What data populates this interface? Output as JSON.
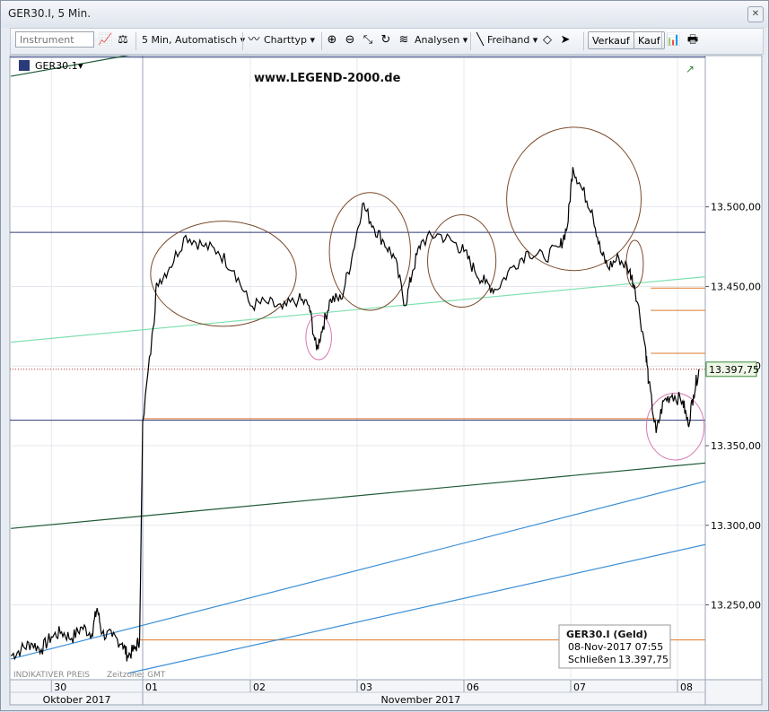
{
  "window": {
    "title": "GER30.I, 5 Min."
  },
  "toolbar": {
    "instrument_placeholder": "Instrument",
    "interval": "5 Min,  Automatisch",
    "charttype": "Charttyp",
    "analysen": "Analysen",
    "freihand": "Freihand",
    "verkauf": "Verkauf",
    "kauf": "Kauf"
  },
  "chart": {
    "symbol": "GER30.1",
    "watermark": "www.LEGEND-2000.de",
    "footer_left": "INDIKATIVER PREIS",
    "footer_zone": "Zeitzone: GMT",
    "current_price_label": "13.397,75",
    "info_box": {
      "title": "GER30.I (Geld)",
      "datetime": "08-Nov-2017 07:55",
      "close_label": "Schließen",
      "close_value": "13.397,75"
    },
    "colors": {
      "price": "#000000",
      "h_navy": "#2b3a78",
      "h_orange": "#e07a2c",
      "trend_mint": "#7fe0b0",
      "trend_dark_green": "#1f5a36",
      "trend_blue": "#3d8fd6",
      "circle_brown": "#7a4a2a",
      "circle_pink": "#d678b0"
    }
  },
  "chart_data": {
    "type": "line",
    "y_axis": {
      "range": [
        13203,
        13595
      ],
      "ticks": [
        13250,
        13300,
        13350,
        13400,
        13450,
        13500
      ],
      "tick_labels": [
        "13.250,00",
        "13.300,00",
        "13.350,00",
        "13.400,00",
        "13.450,00",
        "13.500,00"
      ]
    },
    "x_axis": {
      "day_ticks": [
        {
          "label": "30",
          "x": 0.1
        },
        {
          "label": "01",
          "x": 1
        },
        {
          "label": "02",
          "x": 2
        },
        {
          "label": "03",
          "x": 3
        },
        {
          "label": "06",
          "x": 4
        },
        {
          "label": "07",
          "x": 5
        },
        {
          "label": "08",
          "x": 6
        }
      ],
      "months": [
        {
          "label": "Oktober 2017",
          "x_start": -0.3,
          "x_end": 1
        },
        {
          "label": "November 2017",
          "x_start": 1,
          "x_end": 6.2
        }
      ]
    },
    "series": [
      {
        "points": [
          [
            -0.3,
            13218
          ],
          [
            -0.2,
            13222
          ],
          [
            -0.1,
            13226
          ],
          [
            0,
            13222
          ],
          [
            0.1,
            13230
          ],
          [
            0.2,
            13233
          ],
          [
            0.3,
            13229
          ],
          [
            0.4,
            13236
          ],
          [
            0.5,
            13232
          ],
          [
            0.55,
            13248
          ],
          [
            0.6,
            13232
          ],
          [
            0.7,
            13230
          ],
          [
            0.8,
            13226
          ],
          [
            0.85,
            13218
          ],
          [
            0.92,
            13222
          ],
          [
            0.97,
            13228
          ],
          [
            1.0,
            13365
          ],
          [
            1.1,
            13425
          ],
          [
            1.13,
            13452
          ],
          [
            1.25,
            13462
          ],
          [
            1.4,
            13482
          ],
          [
            1.55,
            13476
          ],
          [
            1.7,
            13472
          ],
          [
            1.85,
            13460
          ],
          [
            2.0,
            13438
          ],
          [
            2.15,
            13440
          ],
          [
            2.3,
            13436
          ],
          [
            2.45,
            13442
          ],
          [
            2.55,
            13438
          ],
          [
            2.62,
            13410
          ],
          [
            2.68,
            13425
          ],
          [
            2.75,
            13442
          ],
          [
            2.85,
            13442
          ],
          [
            2.95,
            13468
          ],
          [
            3.05,
            13502
          ],
          [
            3.15,
            13488
          ],
          [
            3.25,
            13478
          ],
          [
            3.35,
            13468
          ],
          [
            3.45,
            13438
          ],
          [
            3.52,
            13460
          ],
          [
            3.6,
            13478
          ],
          [
            3.75,
            13483
          ],
          [
            3.9,
            13478
          ],
          [
            4.0,
            13472
          ],
          [
            4.1,
            13460
          ],
          [
            4.2,
            13452
          ],
          [
            4.3,
            13448
          ],
          [
            4.45,
            13462
          ],
          [
            4.6,
            13472
          ],
          [
            4.75,
            13468
          ],
          [
            4.9,
            13475
          ],
          [
            4.97,
            13488
          ],
          [
            5.02,
            13525
          ],
          [
            5.1,
            13512
          ],
          [
            5.2,
            13498
          ],
          [
            5.28,
            13472
          ],
          [
            5.35,
            13462
          ],
          [
            5.45,
            13468
          ],
          [
            5.55,
            13460
          ],
          [
            5.6,
            13450
          ],
          [
            5.7,
            13412
          ],
          [
            5.73,
            13390
          ],
          [
            5.8,
            13358
          ],
          [
            5.87,
            13378
          ],
          [
            5.95,
            13382
          ],
          [
            6.05,
            13378
          ],
          [
            6.1,
            13363
          ],
          [
            6.15,
            13382
          ],
          [
            6.2,
            13398
          ]
        ]
      }
    ],
    "annotations": {
      "horizontal_lines": [
        {
          "price": 13594,
          "color": "h_navy"
        },
        {
          "price": 13484,
          "color": "h_navy"
        },
        {
          "price": 13366,
          "color": "h_navy"
        },
        {
          "price": 13449,
          "color": "h_orange",
          "x_from": 5.75
        },
        {
          "price": 13435,
          "color": "h_orange",
          "x_from": 5.75
        },
        {
          "price": 13408,
          "color": "h_orange",
          "x_from": 5.75
        },
        {
          "price": 13367,
          "color": "h_orange",
          "x_from": 1.0,
          "x_to": 5.8
        },
        {
          "price": 13228,
          "color": "h_orange",
          "x_from": 0.95
        }
      ],
      "trend_lines": [
        {
          "from": [
            -0.3,
            13415
          ],
          "to": [
            6.4,
            13457
          ],
          "color": "trend_mint"
        },
        {
          "from": [
            -0.3,
            13298
          ],
          "to": [
            6.4,
            13340
          ],
          "color": "trend_dark_green"
        },
        {
          "from": [
            -0.3,
            13216
          ],
          "to": [
            6.4,
            13330
          ],
          "color": "trend_blue"
        },
        {
          "from": [
            0.85,
            13207
          ],
          "to": [
            6.4,
            13290
          ],
          "color": "trend_blue"
        },
        {
          "from": [
            -0.3,
            13582
          ],
          "to": [
            1.6,
            13604
          ],
          "color": "trend_dark_green"
        }
      ],
      "ellipses": [
        {
          "cx": 1.75,
          "cy": 13458,
          "rx": 0.68,
          "ry": 33,
          "color": "circle_brown"
        },
        {
          "cx": 3.12,
          "cy": 13472,
          "rx": 0.38,
          "ry": 37,
          "color": "circle_brown"
        },
        {
          "cx": 3.98,
          "cy": 13466,
          "rx": 0.32,
          "ry": 29,
          "color": "circle_brown"
        },
        {
          "cx": 5.03,
          "cy": 13505,
          "rx": 0.63,
          "ry": 45,
          "color": "circle_brown"
        },
        {
          "cx": 5.6,
          "cy": 13464,
          "rx": 0.08,
          "ry": 15,
          "color": "circle_brown"
        },
        {
          "cx": 2.64,
          "cy": 13418,
          "rx": 0.12,
          "ry": 14,
          "color": "circle_pink"
        },
        {
          "cx": 5.98,
          "cy": 13362,
          "rx": 0.27,
          "ry": 21,
          "color": "circle_pink"
        }
      ]
    }
  }
}
